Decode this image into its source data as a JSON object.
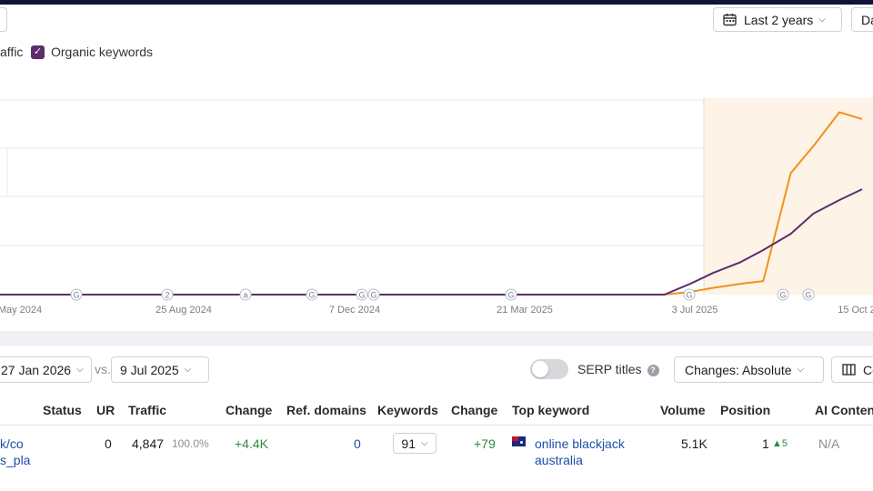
{
  "toolbar": {
    "date_range_label": "Last 2 years",
    "right_cut_label": "Da"
  },
  "legend": {
    "traffic_label": "affic",
    "organic_keywords_label": "Organic keywords",
    "organic_checked_glyph": "✓"
  },
  "chart_data": {
    "type": "line",
    "x_tick_labels": [
      "May 2024",
      "25 Aug 2024",
      "7 Dec 2024",
      "21 Mar 2025",
      "3 Jul 2025",
      "15 Oct 2"
    ],
    "annotation_markers": [
      "G",
      "2",
      "a",
      "G",
      "G",
      "G",
      "G",
      "G",
      "G",
      "G"
    ],
    "highlighted_range_start": "9 Jul 2025",
    "series": [
      {
        "name": "Organic keywords",
        "color": "#5c2d6e",
        "x": [
          "2024-04",
          "2024-08",
          "2024-12",
          "2025-03",
          "2025-06-15",
          "2025-07-01",
          "2025-07-15",
          "2025-08-01",
          "2025-08-15",
          "2025-09-01",
          "2025-09-15",
          "2025-10-01",
          "2025-10-15"
        ],
        "values": [
          0,
          0,
          0,
          0,
          0,
          8,
          16,
          24,
          33,
          45,
          60,
          70,
          78
        ]
      },
      {
        "name": "Organic traffic",
        "color": "#f0921e",
        "x": [
          "2024-04",
          "2024-08",
          "2024-12",
          "2025-03",
          "2025-06-15",
          "2025-07-01",
          "2025-07-15",
          "2025-08-01",
          "2025-08-15",
          "2025-09-01",
          "2025-09-15",
          "2025-10-01",
          "2025-10-15"
        ],
        "values": [
          0,
          0,
          0,
          0,
          0,
          2,
          5,
          8,
          10,
          90,
          110,
          135,
          130
        ]
      }
    ],
    "colors": {
      "keywords": "#5c2d6e",
      "traffic": "#f0921e",
      "highlight": "#fdf3e6"
    }
  },
  "compare": {
    "date_a": "27 Jan 2026",
    "vs_label": "vs.",
    "date_b": "9 Jul 2025",
    "serp_titles_label": "SERP titles",
    "help_glyph": "?",
    "changes_label": "Changes: Absolute",
    "columns_label": "Co"
  },
  "table": {
    "headers": [
      "Status",
      "UR",
      "Traffic",
      "Change",
      "Ref. domains",
      "Keywords",
      "Change",
      "Top keyword",
      "Volume",
      "Position",
      "AI Content"
    ],
    "row": {
      "url_line1": "k/co",
      "url_line2": "s_pla",
      "status": "",
      "ur": "0",
      "traffic": "4,847",
      "traffic_share": "100.0%",
      "traffic_change": "+4.4K",
      "ref_domains": "0",
      "keywords": "91",
      "keywords_change": "+79",
      "top_keyword_line1": "online blackjack",
      "top_keyword_line2": "australia",
      "volume": "5.1K",
      "position": "1",
      "position_change": "▲5",
      "ai_content": "N/A"
    }
  }
}
